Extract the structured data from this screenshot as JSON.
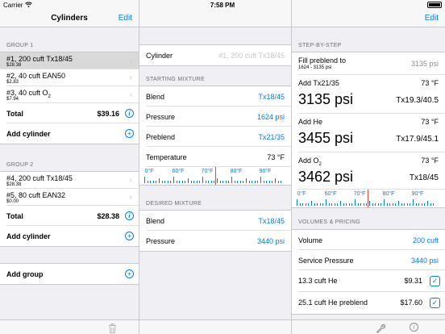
{
  "status": {
    "carrier": "Carrier",
    "wifi_icon": "wifi-icon",
    "time": "7:58 PM",
    "battery_label": "100%"
  },
  "left": {
    "title": "Cylinders",
    "edit": "Edit",
    "group1": {
      "header": "GROUP 1",
      "items": [
        {
          "name": "#1, 200 cuft Tx18/45",
          "price": "$28.38",
          "selected": true
        },
        {
          "name": "#2, 40 cuft EAN50",
          "price": "$2.83"
        },
        {
          "name": "#3, 40 cuft O",
          "sub": "2",
          "price": "$7.94"
        }
      ],
      "total_label": "Total",
      "total_value": "$39.16",
      "add_label": "Add cylinder"
    },
    "group2": {
      "header": "GROUP 2",
      "items": [
        {
          "name": "#4, 200 cuft Tx18/45",
          "price": "$28.38"
        },
        {
          "name": "#5, 80 cuft EAN32",
          "price": "$0.00"
        }
      ],
      "total_label": "Total",
      "total_value": "$28.38",
      "add_label": "Add cylinder"
    },
    "add_group": "Add group",
    "info_glyph": "i",
    "plus_glyph": "+"
  },
  "middle": {
    "cylinder_label": "Cylinder",
    "cylinder_value": "#1, 200 cuft Tx18/45",
    "starting_header": "STARTING MIXTURE",
    "starting": {
      "blend_label": "Blend",
      "blend_value": "Tx18/45",
      "pressure_label": "Pressure",
      "pressure_value": "1624 psi",
      "preblend_label": "Preblend",
      "preblend_value": "Tx21/35",
      "temp_label": "Temperature",
      "temp_value": "73 °F"
    },
    "ruler_labels": [
      "0°F",
      "60°F",
      "70°F",
      "80°F",
      "90°F"
    ],
    "desired_header": "DESIRED MIXTURE",
    "desired": {
      "blend_label": "Blend",
      "blend_value": "Tx18/45",
      "pressure_label": "Pressure",
      "pressure_value": "3440 psi"
    }
  },
  "right": {
    "edit": "Edit",
    "step_header": "STEP-BY-STEP",
    "fill_preblend": {
      "label": "Fill preblend to",
      "sub": "1624 - 3135 psi",
      "value": "3135 psi"
    },
    "step1": {
      "label": "Add Tx21/35",
      "temp": "73 °F",
      "pressure": "3135 psi",
      "mix": "Tx19.3/40.5"
    },
    "step2": {
      "label": "Add He",
      "temp": "73 °F",
      "pressure": "3455 psi",
      "mix": "Tx17.9/45.1"
    },
    "step3": {
      "label": "Add O",
      "sub": "2",
      "temp": "73 °F",
      "pressure": "3462 psi",
      "mix": "Tx18/45"
    },
    "ruler_labels": [
      "0°F",
      "60°F",
      "70°F",
      "80°F",
      "90°F"
    ],
    "volumes_header": "VOLUMES & PRICING",
    "volume_label": "Volume",
    "volume_value": "200 cuft",
    "service_label": "Service Pressure",
    "service_value": "3440 psi",
    "price1": {
      "label": "13.3 cuft He",
      "value": "$9.31"
    },
    "price2": {
      "label": "25.1 cuft He preblend",
      "value": "$17.60"
    },
    "check_glyph": "✓"
  },
  "toolbar": {
    "trash_icon": "trash-icon",
    "wrench_icon": "wrench-icon",
    "info_icon": "info-icon",
    "info_glyph": "i"
  }
}
